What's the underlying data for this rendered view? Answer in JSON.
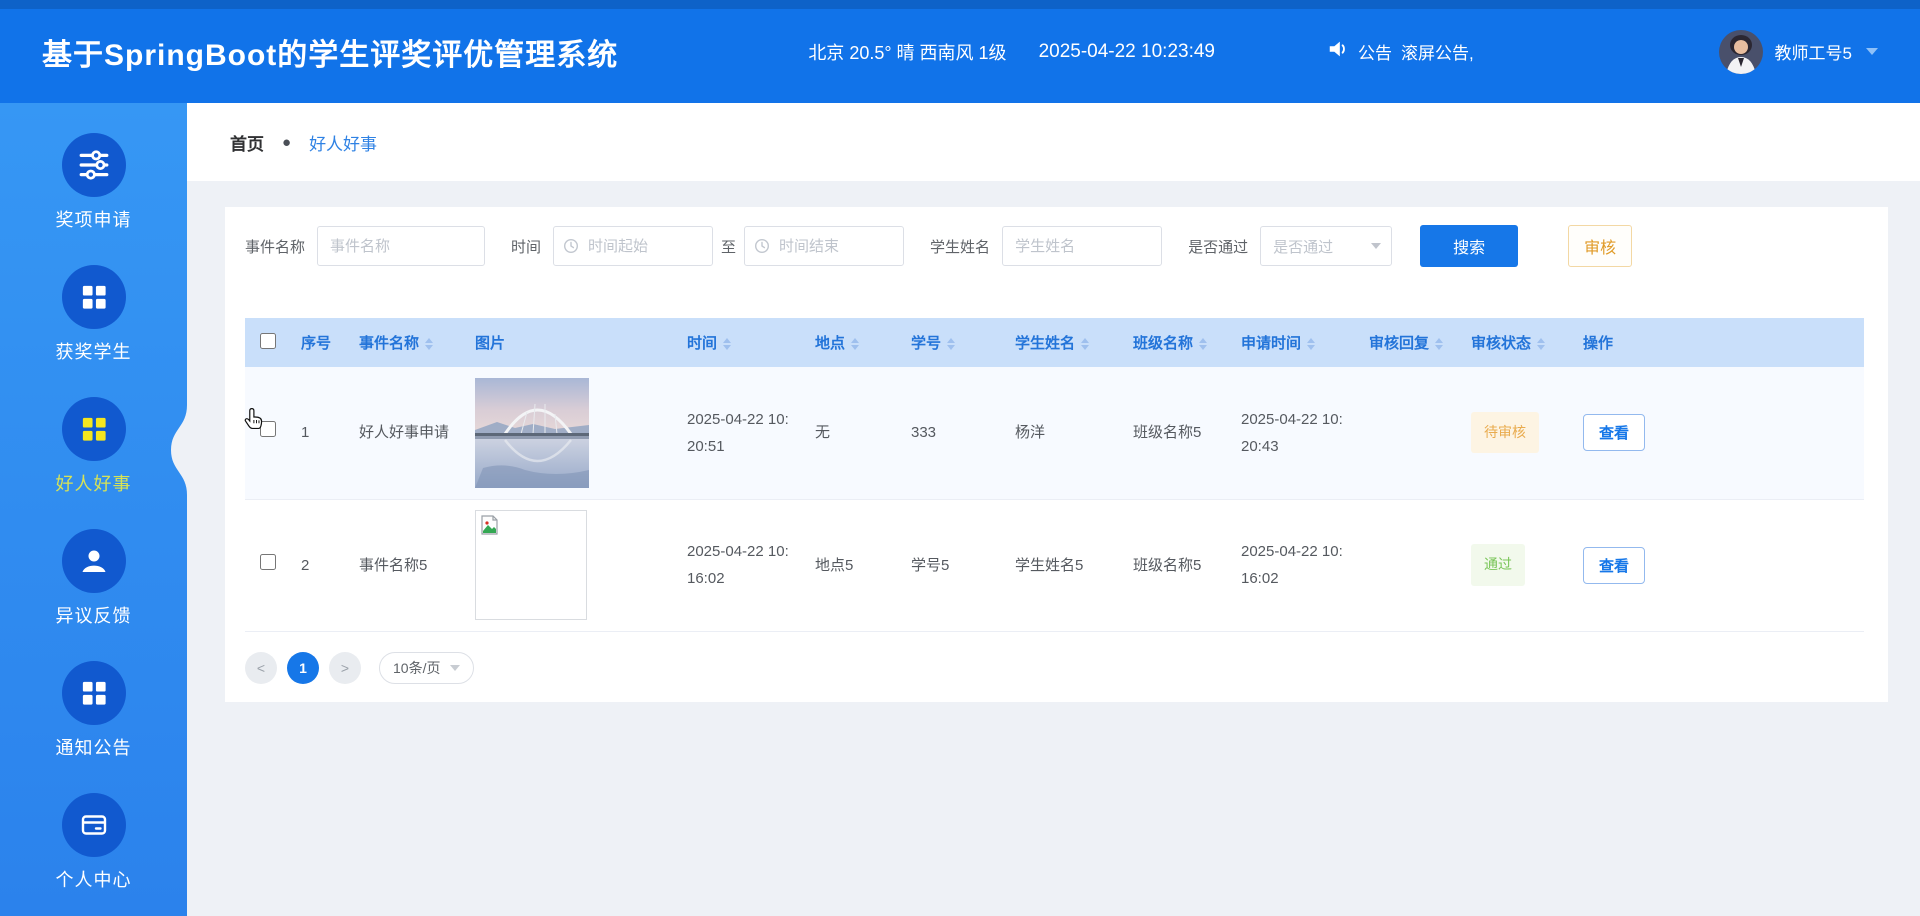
{
  "header": {
    "title": "基于SpringBoot的学生评奖评优管理系统",
    "weather": "北京  20.5°  晴  西南风  1级",
    "datetime": "2025-04-22 10:23:49",
    "announce_label": "公告",
    "announce_text": "滚屏公告,",
    "user_name": "教师工号5"
  },
  "sidebar": {
    "items": [
      {
        "label": "奖项申请",
        "icon": "sliders-icon",
        "active": false
      },
      {
        "label": "获奖学生",
        "icon": "grid-icon",
        "active": false
      },
      {
        "label": "好人好事",
        "icon": "grid-icon",
        "active": true
      },
      {
        "label": "异议反馈",
        "icon": "user-icon",
        "active": false
      },
      {
        "label": "通知公告",
        "icon": "grid-icon",
        "active": false
      },
      {
        "label": "个人中心",
        "icon": "card-icon",
        "active": false
      }
    ]
  },
  "breadcrumb": {
    "home": "首页",
    "separator": "●",
    "current": "好人好事"
  },
  "filters": {
    "event_name_label": "事件名称",
    "event_name_placeholder": "事件名称",
    "time_label": "时间",
    "time_start_placeholder": "时间起始",
    "to_label": "至",
    "time_end_placeholder": "时间结束",
    "student_name_label": "学生姓名",
    "student_name_placeholder": "学生姓名",
    "pass_label": "是否通过",
    "pass_placeholder": "是否通过",
    "search_button": "搜索",
    "review_button": "审核"
  },
  "table": {
    "columns": [
      "序号",
      "事件名称",
      "图片",
      "时间",
      "地点",
      "学号",
      "学生姓名",
      "班级名称",
      "申请时间",
      "审核回复",
      "审核状态",
      "操作"
    ],
    "rows": [
      {
        "index": "1",
        "event_name": "好人好事申请",
        "image": "bridge-photo",
        "time": "2025-04-22 10:20:51",
        "location": "无",
        "student_id": "333",
        "student_name": "杨洋",
        "class_name": "班级名称5",
        "apply_time": "2025-04-22 10:20:43",
        "review_reply": "",
        "status": "待审核",
        "status_type": "pending",
        "action": "查看"
      },
      {
        "index": "2",
        "event_name": "事件名称5",
        "image": "broken",
        "time": "2025-04-22 10:16:02",
        "location": "地点5",
        "student_id": "学号5",
        "student_name": "学生姓名5",
        "class_name": "班级名称5",
        "apply_time": "2025-04-22 10:16:02",
        "review_reply": "",
        "status": "通过",
        "status_type": "passed",
        "action": "查看"
      }
    ]
  },
  "pagination": {
    "prev": "<",
    "current": "1",
    "next": ">",
    "page_size": "10条/页"
  },
  "colors": {
    "header_blue": "#1173e9",
    "sidebar_blue": "#2d8cf0",
    "accent": "#1677e8",
    "table_header_bg": "#c9dffa",
    "pending_orange": "#e9ab4e",
    "passed_green": "#79c558",
    "active_menu_yellow": "#d7e356"
  }
}
